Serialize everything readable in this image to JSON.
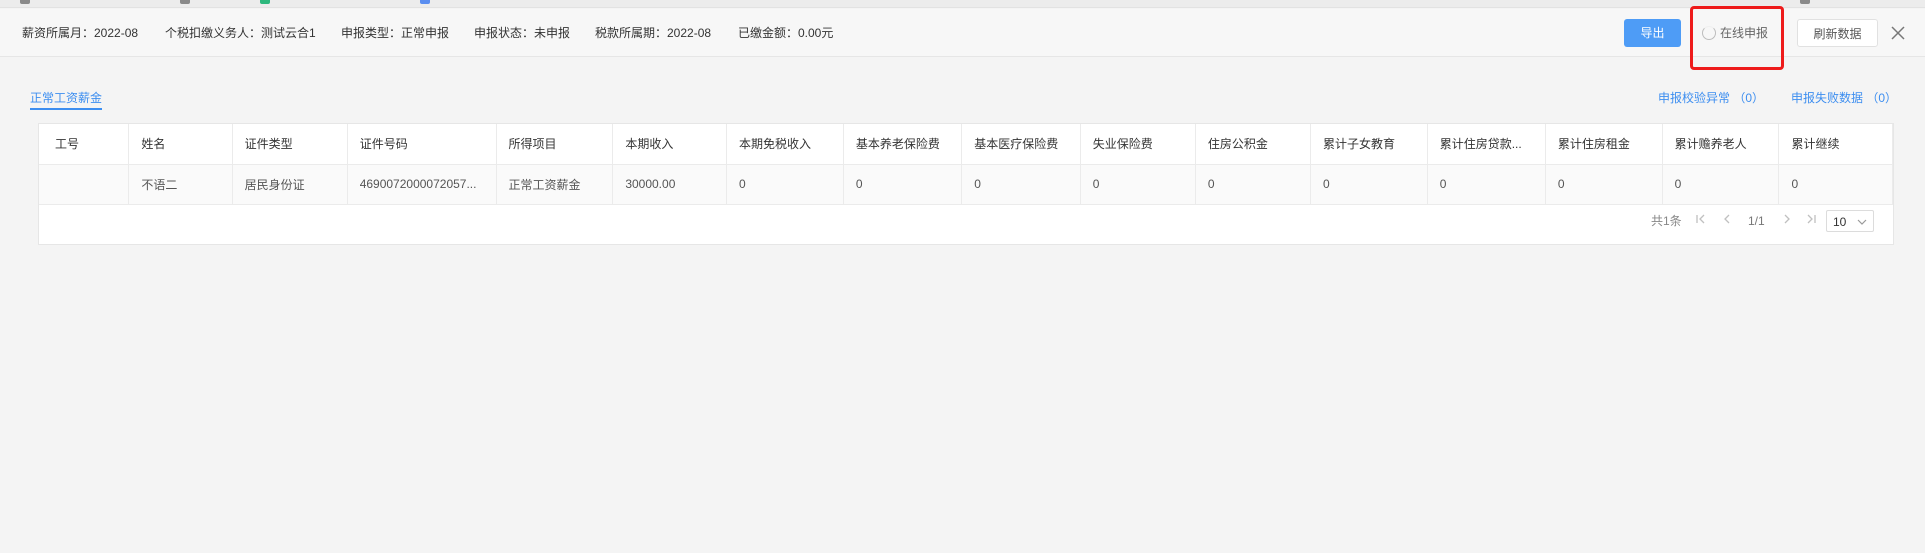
{
  "info_bar": {
    "salary_month": "薪资所属月：2022-08",
    "withholding_agent": "个税扣缴义务人：测试云合1",
    "declare_type": "申报类型：正常申报",
    "declare_status": "申报状态：未申报",
    "tax_period": "税款所属期：2022-08",
    "paid_amount": "已缴金额：0.00元"
  },
  "toolbar": {
    "export_label": "导出",
    "online_declare_label": "在线申报",
    "refresh_label": "刷新数据"
  },
  "tabs": [
    {
      "label": "正常工资薪金",
      "active": true
    }
  ],
  "links": {
    "validation_error": "申报校验异常 （0）",
    "failed_data": "申报失败数据 （0）"
  },
  "table": {
    "columns": [
      "工号",
      "姓名",
      "证件类型",
      "证件号码",
      "所得项目",
      "本期收入",
      "本期免税收入",
      "基本养老保险费",
      "基本医疗保险费",
      "失业保险费",
      "住房公积金",
      "累计子女教育",
      "累计住房贷款...",
      "累计住房租金",
      "累计赡养老人",
      "累计继续"
    ],
    "rows": [
      [
        "",
        "不语二",
        "居民身份证",
        "4690072000072057...",
        "正常工资薪金",
        "30000.00",
        "0",
        "0",
        "0",
        "0",
        "0",
        "0",
        "0",
        "0",
        "0",
        "0"
      ]
    ]
  },
  "pagination": {
    "total": "共1条",
    "page": "1/1",
    "page_size": "10"
  },
  "colors": {
    "accent": "#3d8ef0",
    "export_button": "#4e9cf6",
    "highlight_border": "#ee1b1b"
  },
  "icons": {
    "close": "close-icon",
    "spinner": "loading-spinner-icon",
    "page_first": "page-first-icon",
    "page_prev": "chevron-left-icon",
    "page_next": "chevron-right-icon",
    "page_last": "page-last-icon",
    "dropdown": "chevron-down-icon"
  }
}
